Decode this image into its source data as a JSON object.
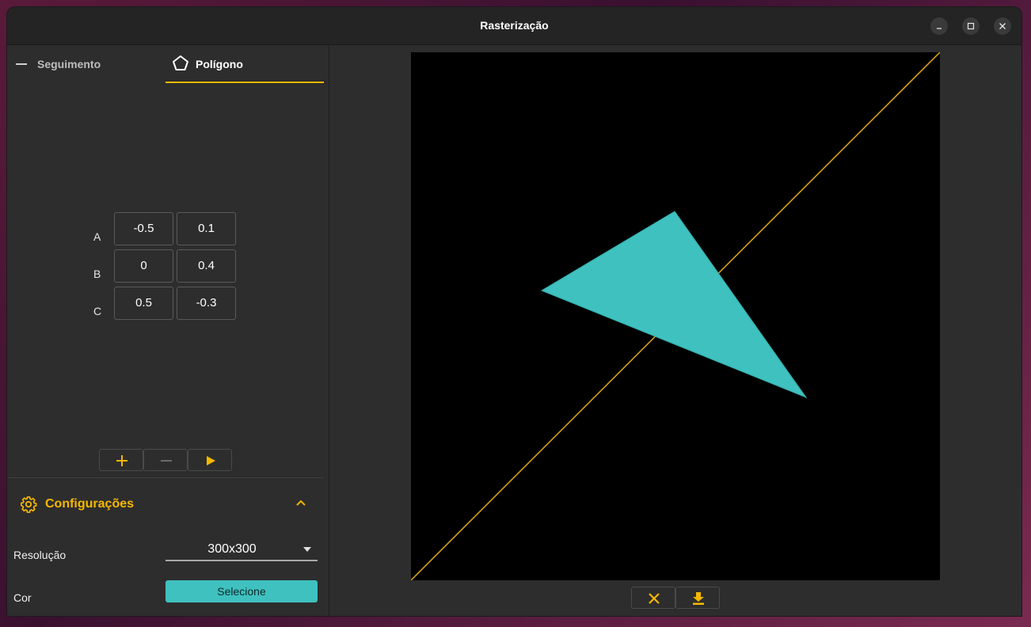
{
  "window": {
    "title": "Rasterização"
  },
  "tabs": [
    {
      "label": "Seguimento",
      "icon": "line-icon",
      "selected": false
    },
    {
      "label": "Polígono",
      "icon": "pentagon-icon",
      "selected": true
    }
  ],
  "vertices": [
    {
      "label": "A",
      "x": "-0.5",
      "y": "0.1"
    },
    {
      "label": "B",
      "x": "0",
      "y": "0.4"
    },
    {
      "label": "C",
      "x": "0.5",
      "y": "-0.3"
    }
  ],
  "toolbar": {
    "add_icon": "plus-icon",
    "remove_icon": "minus-icon",
    "run_icon": "play-icon"
  },
  "config": {
    "title": "Configurações",
    "resolution_label": "Resolução",
    "resolution_value": "300x300",
    "color_label": "Cor",
    "color_button": "Selecione"
  },
  "canvas": {
    "line_color": "#d4a017",
    "fill_color": "#3fc1bf",
    "background": "#000000"
  },
  "bottom_toolbar": {
    "clear_icon": "close-icon",
    "download_icon": "download-icon"
  },
  "colors": {
    "accent": "#f5b800",
    "teal": "#3fc1bf"
  }
}
